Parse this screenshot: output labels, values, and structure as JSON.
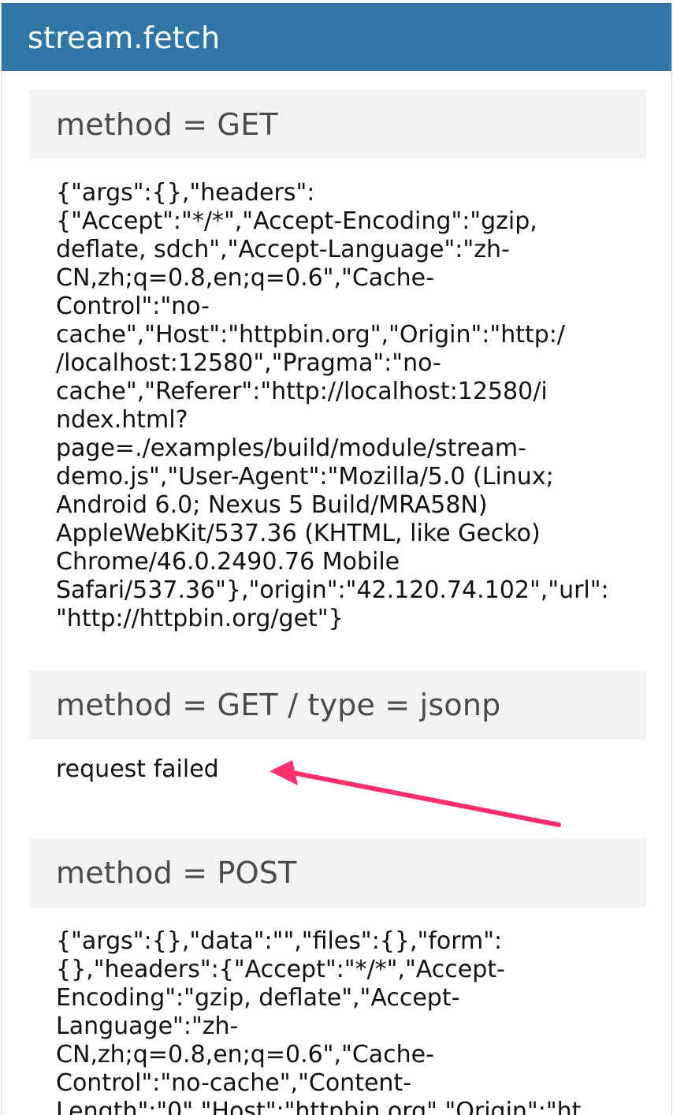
{
  "header": {
    "title": "stream.fetch"
  },
  "sections": [
    {
      "title": "method = GET",
      "body": "{\"args\":{},\"headers\":\n{\"Accept\":\"*/*\",\"Accept-Encoding\":\"gzip,\ndeflate, sdch\",\"Accept-Language\":\"zh-\nCN,zh;q=0.8,en;q=0.6\",\"Cache-\nControl\":\"no-\ncache\",\"Host\":\"httpbin.org\",\"Origin\":\"http:/\n/localhost:12580\",\"Pragma\":\"no-\ncache\",\"Referer\":\"http://localhost:12580/i\nndex.html?\npage=./examples/build/module/stream-\ndemo.js\",\"User-Agent\":\"Mozilla/5.0 (Linux;\nAndroid 6.0; Nexus 5 Build/MRA58N)\nAppleWebKit/537.36 (KHTML, like Gecko)\nChrome/46.0.2490.76 Mobile\nSafari/537.36\"},\"origin\":\"42.120.74.102\",\"url\":\n\"http://httpbin.org/get\"}"
    },
    {
      "title": "method = GET / type = jsonp",
      "body": "request failed"
    },
    {
      "title": "method = POST",
      "body": "{\"args\":{},\"data\":\"\",\"files\":{},\"form\":\n{},\"headers\":{\"Accept\":\"*/*\",\"Accept-\nEncoding\":\"gzip, deflate\",\"Accept-\nLanguage\":\"zh-\nCN,zh;q=0.8,en;q=0.6\",\"Cache-\nControl\":\"no-cache\",\"Content-\nLength\":\"0\",\"Host\":\"httpbin.org\",\"Origin\":\"ht"
    }
  ],
  "colors": {
    "topbar": "#2f76a7",
    "section_header": "#f3f3f3",
    "arrow": "#ff2f6d"
  },
  "icons": {
    "annotation": "arrow-icon"
  }
}
